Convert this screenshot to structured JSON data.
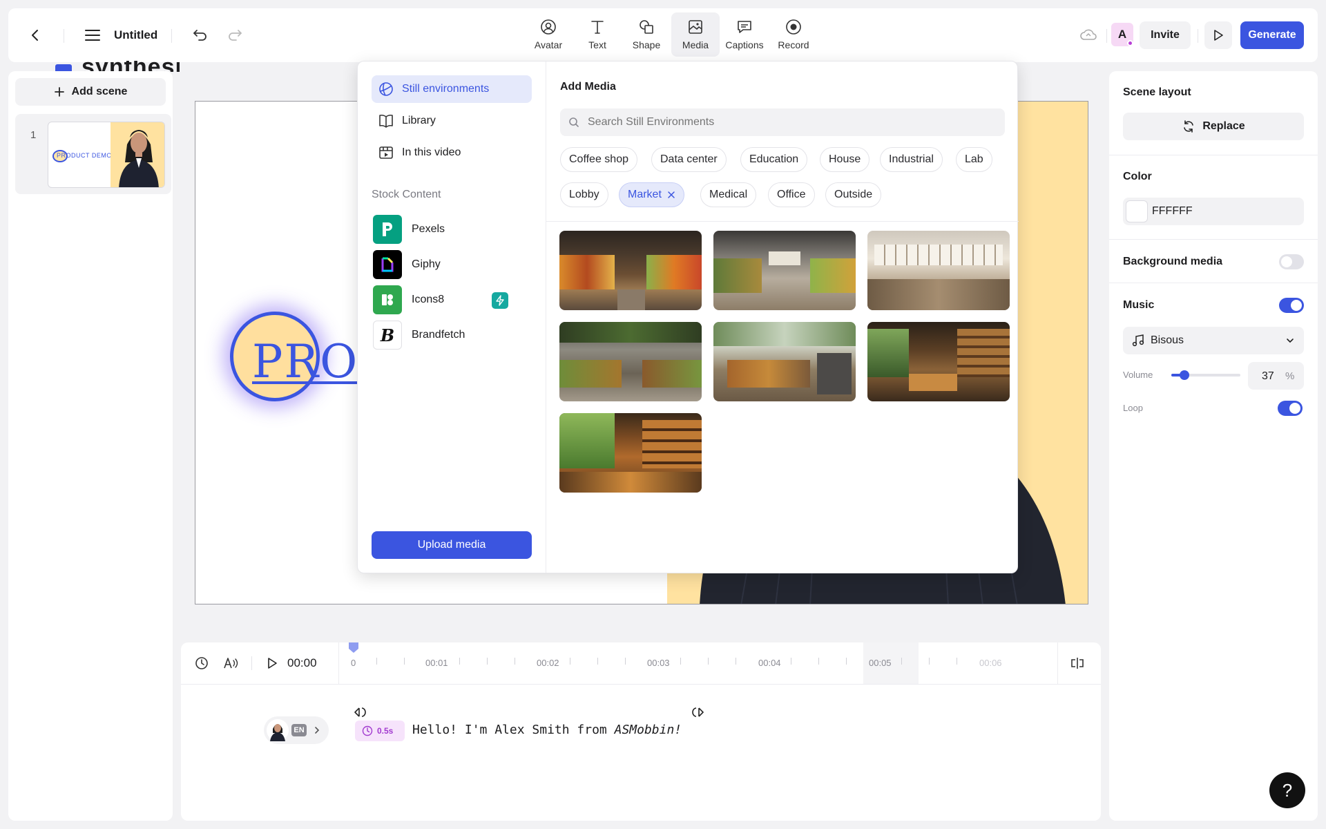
{
  "topbar": {
    "title": "Untitled",
    "tools": [
      {
        "label": "Avatar",
        "icon": "avatar-icon"
      },
      {
        "label": "Text",
        "icon": "text-icon"
      },
      {
        "label": "Shape",
        "icon": "shape-icon"
      },
      {
        "label": "Media",
        "icon": "media-icon"
      },
      {
        "label": "Captions",
        "icon": "captions-icon"
      },
      {
        "label": "Record",
        "icon": "record-icon"
      }
    ],
    "user_initial": "A",
    "invite_label": "Invite",
    "generate_label": "Generate"
  },
  "behind_text": "synthesia",
  "scenes": {
    "add_label": "Add scene",
    "items": [
      {
        "number": "1",
        "thumb_text": "PRODUCT DEMO"
      }
    ]
  },
  "canvas": {
    "logo_text": "PROD"
  },
  "media_panel": {
    "nav": [
      {
        "label": "Still environments",
        "icon": "globe-icon",
        "active": true
      },
      {
        "label": "Library",
        "icon": "book-icon"
      },
      {
        "label": "In this video",
        "icon": "video-frame-icon"
      }
    ],
    "stock_heading": "Stock Content",
    "stock": [
      {
        "label": "Pexels",
        "logo": "P",
        "color": "#05a081"
      },
      {
        "label": "Giphy",
        "logo": "G",
        "color": "#000000"
      },
      {
        "label": "Icons8",
        "logo": "8",
        "color": "#2fa84f",
        "badge": "bolt-icon"
      },
      {
        "label": "Brandfetch",
        "logo": "B",
        "color": "#ffffff"
      }
    ],
    "upload_label": "Upload media",
    "heading": "Add Media",
    "search_placeholder": "Search Still Environments",
    "chips_row1": [
      "Coffee shop",
      "Data center",
      "Education",
      "House",
      "Industrial",
      "Lab"
    ],
    "chips_row2": [
      "Lobby",
      "Market",
      "Medical",
      "Office",
      "Outside"
    ],
    "active_chip": "Market"
  },
  "timeline": {
    "time": "00:00",
    "ticks": [
      "0",
      "00:01",
      "00:02",
      "00:03",
      "00:04",
      "00:05",
      "00:06"
    ],
    "lang": "EN",
    "pause": "0.5s",
    "script_text": "Hello! I'm Alex Smith from ",
    "script_italic": "ASMobbin!"
  },
  "right_panel": {
    "scene_layout_label": "Scene layout",
    "replace_label": "Replace",
    "color_label": "Color",
    "color_value": "FFFFFF",
    "bg_media_label": "Background media",
    "bg_media_on": false,
    "music_label": "Music",
    "music_on": true,
    "music_track": "Bisous",
    "volume_label": "Volume",
    "volume_value": "37",
    "volume_unit": "%",
    "loop_label": "Loop",
    "loop_on": true
  },
  "help_label": "?"
}
